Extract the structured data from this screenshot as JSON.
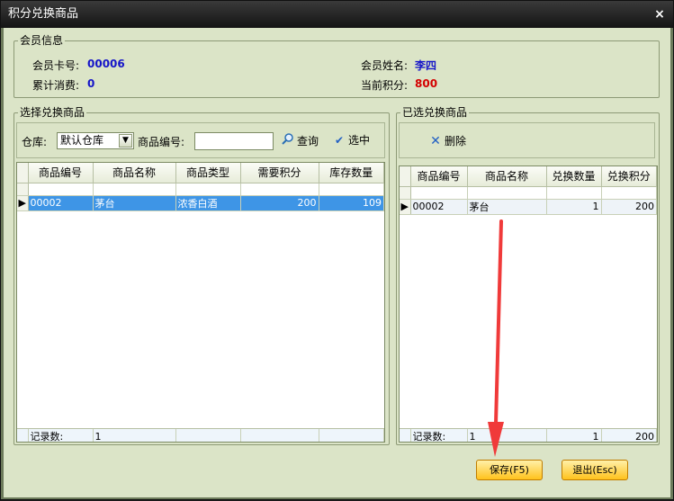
{
  "window": {
    "title": "积分兑换商品",
    "close_glyph": "×"
  },
  "member": {
    "legend": "会员信息",
    "card_label": "会员卡号:",
    "card_value": "00006",
    "name_label": "会员姓名:",
    "name_value": "李四",
    "total_label": "累计消费:",
    "total_value": "0",
    "points_label": "当前积分:",
    "points_value": "800"
  },
  "left": {
    "legend": "选择兑换商品",
    "warehouse_label": "仓库:",
    "warehouse_value": "默认仓库",
    "code_label": "商品编号:",
    "code_value": "",
    "query_label": "查询",
    "select_label": "选中",
    "columns": [
      "商品编号",
      "商品名称",
      "商品类型",
      "需要积分",
      "库存数量"
    ],
    "rows": [
      {
        "code": "00002",
        "name": "茅台",
        "type": "浓香白酒",
        "points": "200",
        "stock": "109"
      }
    ],
    "footer_label": "记录数:",
    "footer_count": "1"
  },
  "right": {
    "legend": "已选兑换商品",
    "delete_label": "删除",
    "columns": [
      "商品编号",
      "商品名称",
      "兑换数量",
      "兑换积分"
    ],
    "rows": [
      {
        "code": "00002",
        "name": "茅台",
        "qty": "1",
        "points": "200"
      }
    ],
    "footer_label": "记录数:",
    "footer_count": "1",
    "footer_qty": "1",
    "footer_points": "200"
  },
  "buttons": {
    "save": "保存(F5)",
    "exit": "退出(Esc)"
  },
  "colors": {
    "accent_arrow": "#f03a3a",
    "selected_row": "#3e95e6",
    "button_fill": "#ffc21c"
  }
}
